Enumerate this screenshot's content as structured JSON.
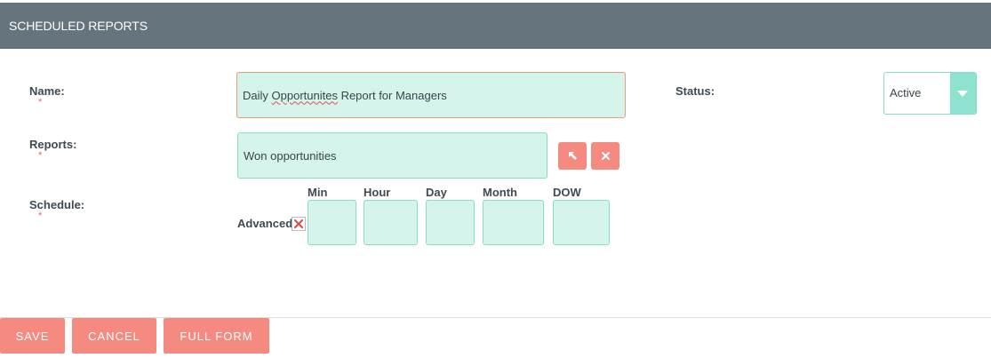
{
  "header": {
    "title": "SCHEDULED REPORTS"
  },
  "form": {
    "name": {
      "label": "Name:",
      "required_mark": "*",
      "value_prefix": "Daily ",
      "value_misspelled": "Opportunites",
      "value_suffix": " Report for Managers"
    },
    "status": {
      "label": "Status:",
      "selected": "Active"
    },
    "reports": {
      "label": "Reports:",
      "required_mark": "*",
      "value": "Won opportunities"
    },
    "schedule": {
      "label": "Schedule:",
      "required_mark": "*",
      "advanced_label": "Advanced",
      "advanced_checked": true,
      "columns": [
        "Min",
        "Hour",
        "Day",
        "Month",
        "DOW"
      ]
    }
  },
  "icons": {
    "select_report": "cursor-arrow-icon",
    "clear_report": "close-icon",
    "advanced_checkbox": "x-mark-icon"
  },
  "colors": {
    "header_bg": "#66747d",
    "field_bg": "#d4f4ec",
    "field_border": "#89dcc8",
    "button_bg": "#f48a80",
    "required": "#e36a5b"
  },
  "buttons": {
    "save": "SAVE",
    "cancel": "CANCEL",
    "full_form": "FULL FORM"
  }
}
